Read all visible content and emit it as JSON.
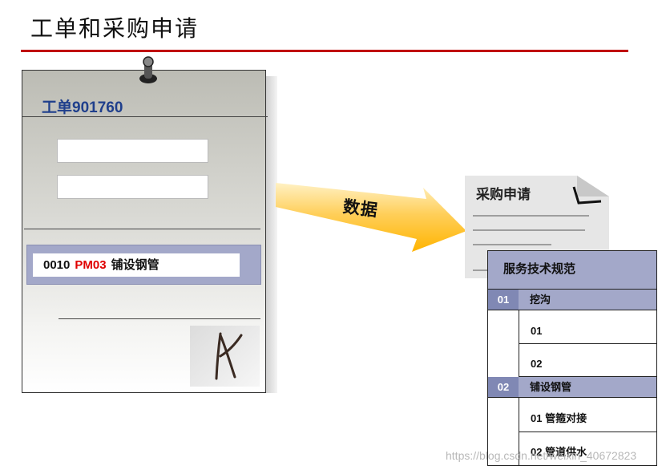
{
  "header": {
    "title": "工单和采购申请"
  },
  "work_order": {
    "title": "工单901760",
    "operation": {
      "number": "0010",
      "control_key": "PM03",
      "description": "铺设钢管"
    }
  },
  "arrow": {
    "label": "数据"
  },
  "purchase_request": {
    "title": "采购申请"
  },
  "service_spec": {
    "title": "服务技术规范",
    "groups": [
      {
        "num": "01",
        "label": "挖沟",
        "items": [
          "01",
          "02"
        ]
      },
      {
        "num": "02",
        "label": "铺设钢管",
        "items": [
          "01 管箍对接",
          "02 管道供水"
        ]
      }
    ]
  },
  "watermark": "https://blog.csdn.net/weixin_40672823",
  "colors": {
    "accent_red": "#c00000",
    "band_blue": "#a3a8c9",
    "title_blue": "#1f3f8c",
    "arrow_orange": "#ffb400"
  }
}
